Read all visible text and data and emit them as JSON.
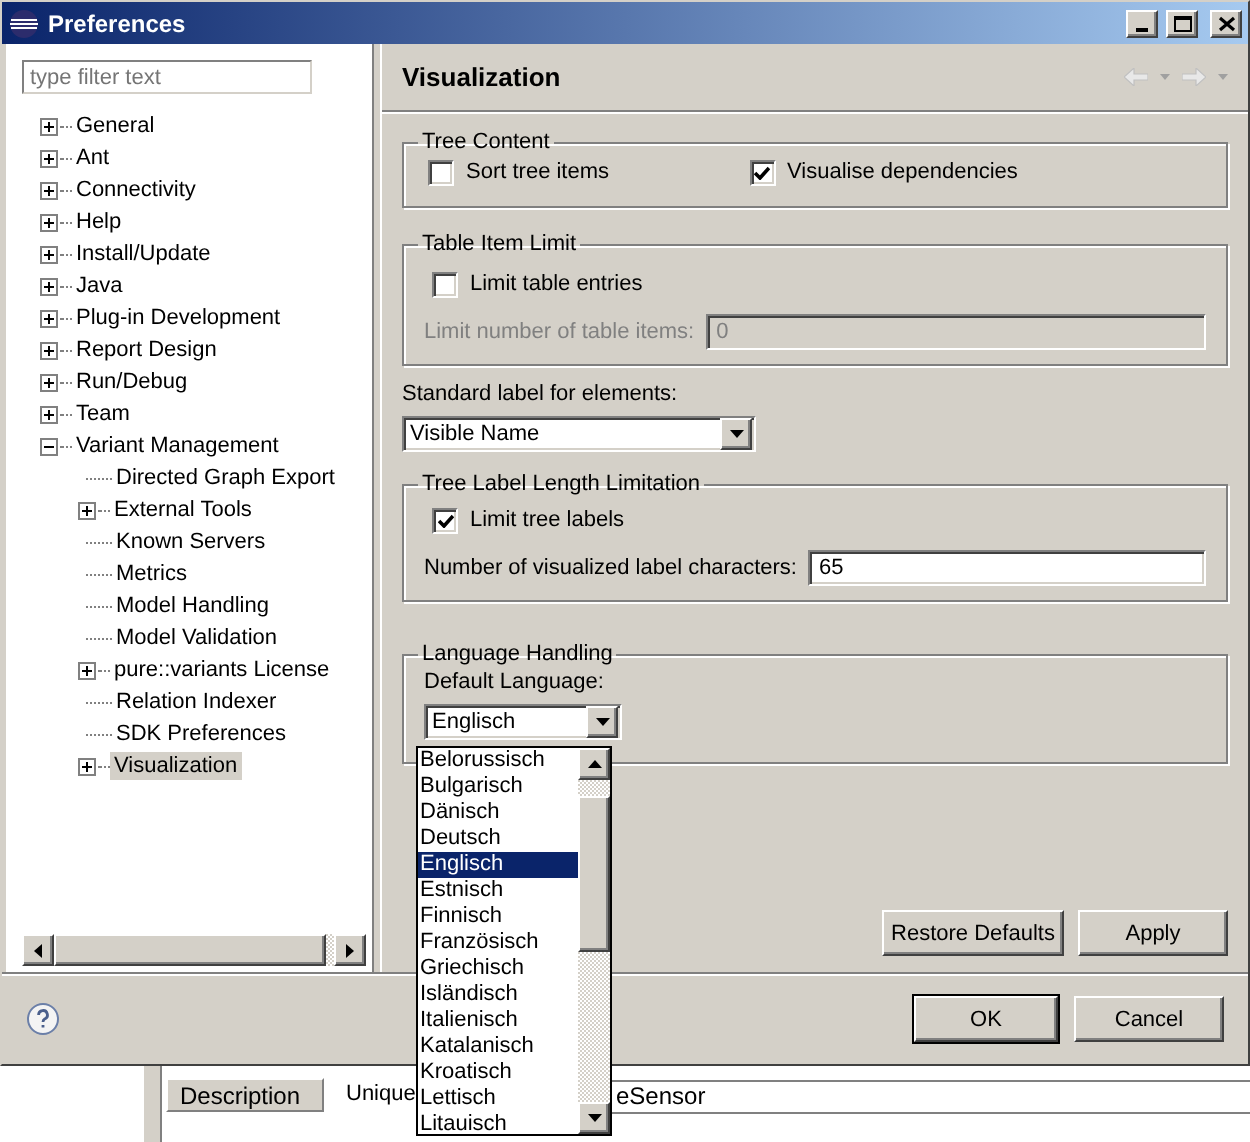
{
  "window": {
    "title": "Preferences"
  },
  "filter": {
    "placeholder": "type filter text"
  },
  "tree": [
    {
      "label": "General",
      "kind": "branch",
      "expanded": false,
      "selected": false
    },
    {
      "label": "Ant",
      "kind": "branch",
      "expanded": false,
      "selected": false
    },
    {
      "label": "Connectivity",
      "kind": "branch",
      "expanded": false,
      "selected": false
    },
    {
      "label": "Help",
      "kind": "branch",
      "expanded": false,
      "selected": false
    },
    {
      "label": "Install/Update",
      "kind": "branch",
      "expanded": false,
      "selected": false
    },
    {
      "label": "Java",
      "kind": "branch",
      "expanded": false,
      "selected": false
    },
    {
      "label": "Plug-in Development",
      "kind": "branch",
      "expanded": false,
      "selected": false
    },
    {
      "label": "Report Design",
      "kind": "branch",
      "expanded": false,
      "selected": false
    },
    {
      "label": "Run/Debug",
      "kind": "branch",
      "expanded": false,
      "selected": false
    },
    {
      "label": "Team",
      "kind": "branch",
      "expanded": false,
      "selected": false
    },
    {
      "label": "Variant Management",
      "kind": "branch",
      "expanded": true,
      "selected": false,
      "children": [
        {
          "label": "Directed Graph Export",
          "kind": "leaf",
          "selected": false
        },
        {
          "label": "External Tools",
          "kind": "branch",
          "expanded": false,
          "selected": false
        },
        {
          "label": "Known Servers",
          "kind": "leaf",
          "selected": false
        },
        {
          "label": "Metrics",
          "kind": "leaf",
          "selected": false
        },
        {
          "label": "Model Handling",
          "kind": "leaf",
          "selected": false
        },
        {
          "label": "Model Validation",
          "kind": "leaf",
          "selected": false
        },
        {
          "label": "pure::variants License",
          "kind": "branch",
          "expanded": false,
          "selected": false
        },
        {
          "label": "Relation Indexer",
          "kind": "leaf",
          "selected": false
        },
        {
          "label": "SDK Preferences",
          "kind": "leaf",
          "selected": false
        },
        {
          "label": "Visualization",
          "kind": "branch",
          "expanded": false,
          "selected": true
        }
      ]
    }
  ],
  "page": {
    "title": "Visualization",
    "tree_content": {
      "legend": "Tree Content",
      "options": [
        {
          "label": "Sort tree items",
          "checked": false
        },
        {
          "label": "Visualise dependencies",
          "checked": true
        }
      ]
    },
    "table_item_limit": {
      "legend": "Table Item Limit",
      "option": {
        "label": "Limit table entries",
        "checked": false
      },
      "field_label": "Limit number of table items:",
      "field_value": "0",
      "disabled": true
    },
    "standard_label": {
      "label": "Standard label for elements:",
      "value": "Visible Name"
    },
    "tree_label_limit": {
      "legend": "Tree Label Length Limitation",
      "option": {
        "label": "Limit tree labels",
        "checked": true
      },
      "field_label": "Number of visualized label characters:",
      "field_value": "65",
      "disabled": false
    },
    "language": {
      "legend": "Language Handling",
      "label": "Default Language:",
      "value": "Englisch",
      "options": [
        {
          "label": "Belorussisch",
          "selected": false
        },
        {
          "label": "Bulgarisch",
          "selected": false
        },
        {
          "label": "Dänisch",
          "selected": false
        },
        {
          "label": "Deutsch",
          "selected": false
        },
        {
          "label": "Englisch",
          "selected": true
        },
        {
          "label": "Estnisch",
          "selected": false
        },
        {
          "label": "Finnisch",
          "selected": false
        },
        {
          "label": "Französisch",
          "selected": false
        },
        {
          "label": "Griechisch",
          "selected": false
        },
        {
          "label": "Isländisch",
          "selected": false
        },
        {
          "label": "Italienisch",
          "selected": false
        },
        {
          "label": "Katalanisch",
          "selected": false
        },
        {
          "label": "Kroatisch",
          "selected": false
        },
        {
          "label": "Lettisch",
          "selected": false
        },
        {
          "label": "Litauisch",
          "selected": false
        }
      ]
    },
    "buttons": [
      "Restore Defaults",
      "Apply"
    ]
  },
  "dialog_buttons": [
    {
      "label": "OK",
      "default": true
    },
    {
      "label": "Cancel",
      "default": false
    }
  ],
  "background": {
    "tab": "Description",
    "label": "Unique",
    "value": "eSensor"
  }
}
